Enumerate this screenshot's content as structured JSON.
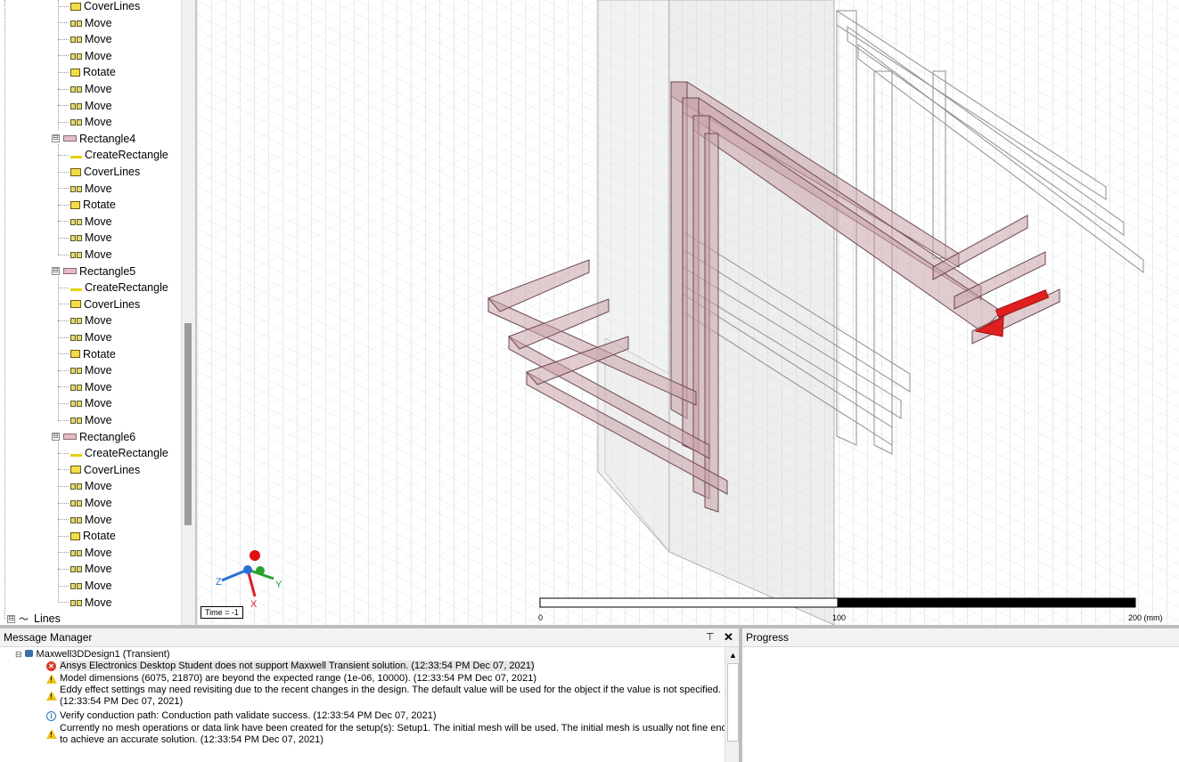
{
  "tree": {
    "items": [
      {
        "label": "CoverLines",
        "icon": "cover-lines-icon",
        "kind": "op"
      },
      {
        "label": "Move",
        "icon": "move-icon",
        "kind": "op"
      },
      {
        "label": "Move",
        "icon": "move-icon",
        "kind": "op"
      },
      {
        "label": "Move",
        "icon": "move-icon",
        "kind": "op"
      },
      {
        "label": "Rotate",
        "icon": "rotate-icon",
        "kind": "op"
      },
      {
        "label": "Move",
        "icon": "move-icon",
        "kind": "op"
      },
      {
        "label": "Move",
        "icon": "move-icon",
        "kind": "op"
      },
      {
        "label": "Move",
        "icon": "move-icon",
        "kind": "op"
      },
      {
        "label": "Rectangle4",
        "icon": "rectangle-icon",
        "kind": "object",
        "expander": "⊟"
      },
      {
        "label": "CreateRectangle",
        "icon": "create-rectangle-icon",
        "kind": "op"
      },
      {
        "label": "CoverLines",
        "icon": "cover-lines-icon",
        "kind": "op"
      },
      {
        "label": "Move",
        "icon": "move-icon",
        "kind": "op"
      },
      {
        "label": "Rotate",
        "icon": "rotate-icon",
        "kind": "op"
      },
      {
        "label": "Move",
        "icon": "move-icon",
        "kind": "op"
      },
      {
        "label": "Move",
        "icon": "move-icon",
        "kind": "op"
      },
      {
        "label": "Move",
        "icon": "move-icon",
        "kind": "op"
      },
      {
        "label": "Rectangle5",
        "icon": "rectangle-icon",
        "kind": "object",
        "expander": "⊟"
      },
      {
        "label": "CreateRectangle",
        "icon": "create-rectangle-icon",
        "kind": "op"
      },
      {
        "label": "CoverLines",
        "icon": "cover-lines-icon",
        "kind": "op"
      },
      {
        "label": "Move",
        "icon": "move-icon",
        "kind": "op"
      },
      {
        "label": "Move",
        "icon": "move-icon",
        "kind": "op"
      },
      {
        "label": "Rotate",
        "icon": "rotate-icon",
        "kind": "op"
      },
      {
        "label": "Move",
        "icon": "move-icon",
        "kind": "op"
      },
      {
        "label": "Move",
        "icon": "move-icon",
        "kind": "op"
      },
      {
        "label": "Move",
        "icon": "move-icon",
        "kind": "op"
      },
      {
        "label": "Move",
        "icon": "move-icon",
        "kind": "op"
      },
      {
        "label": "Rectangle6",
        "icon": "rectangle-icon",
        "kind": "object",
        "expander": "⊟"
      },
      {
        "label": "CreateRectangle",
        "icon": "create-rectangle-icon",
        "kind": "op"
      },
      {
        "label": "CoverLines",
        "icon": "cover-lines-icon",
        "kind": "op"
      },
      {
        "label": "Move",
        "icon": "move-icon",
        "kind": "op"
      },
      {
        "label": "Move",
        "icon": "move-icon",
        "kind": "op"
      },
      {
        "label": "Move",
        "icon": "move-icon",
        "kind": "op"
      },
      {
        "label": "Rotate",
        "icon": "rotate-icon",
        "kind": "op"
      },
      {
        "label": "Move",
        "icon": "move-icon",
        "kind": "op"
      },
      {
        "label": "Move",
        "icon": "move-icon",
        "kind": "op"
      },
      {
        "label": "Move",
        "icon": "move-icon",
        "kind": "op"
      },
      {
        "label": "Move",
        "icon": "move-icon",
        "kind": "op"
      },
      {
        "label": "Lines",
        "icon": "lines-icon",
        "kind": "group",
        "expander": "⊟"
      }
    ]
  },
  "viewport": {
    "time_label": "Time = -1",
    "axes": {
      "x": "X",
      "y": "Y",
      "z": "Z"
    },
    "scale": {
      "labels": [
        "0",
        "100",
        "200 (mm)"
      ]
    },
    "colors": {
      "conductor": "#c9a3a8",
      "arrow": "#e02020",
      "grid": "#c8d0e0"
    }
  },
  "message_manager": {
    "title": "Message Manager",
    "pin": "⊤",
    "close": "✕",
    "design": {
      "expander": "⊟",
      "icon": "design-icon",
      "label": "Maxwell3DDesign1 (Transient)"
    },
    "messages": [
      {
        "severity": "error",
        "lines": [
          "Ansys Electronics Desktop Student does not support Maxwell Transient solution. (12:33:54 PM  Dec 07, 2021)"
        ]
      },
      {
        "severity": "warning",
        "lines": [
          "Model dimensions (6075, 21870) are beyond the expected range (1e-06, 10000).  (12:33:54 PM  Dec 07, 2021)"
        ]
      },
      {
        "severity": "warning",
        "lines": [
          "Eddy effect settings may need revisiting due to the recent changes in the design.  The default value will be used for the object if the value is not specified.",
          "(12:33:54 PM  Dec 07, 2021)"
        ]
      },
      {
        "severity": "info",
        "lines": [
          "Verify conduction path: Conduction path validate success. (12:33:54 PM  Dec 07, 2021)"
        ]
      },
      {
        "severity": "warning",
        "lines": [
          "Currently no mesh operations or data link have been created for the setup(s): Setup1.  The initial mesh will be used.  The initial mesh is usually not fine enough",
          "to achieve an accurate solution. (12:33:54 PM  Dec 07, 2021)"
        ]
      }
    ]
  },
  "progress": {
    "title": "Progress"
  }
}
